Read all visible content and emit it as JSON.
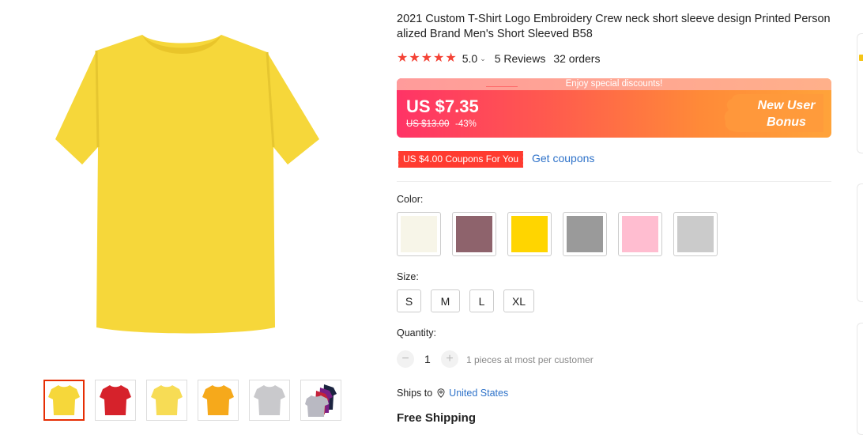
{
  "product": {
    "title": "2021 Custom T-Shirt Logo Embroidery Crew neck short sleeve design Printed Person alized Brand Men's Short Sleeved B58",
    "rating": "5.0",
    "reviews": "5 Reviews",
    "orders": "32 orders",
    "stars": 5
  },
  "gallery": {
    "main_color": "#f6d73a",
    "thumbnails": [
      {
        "color": "#f6d73a",
        "selected": true
      },
      {
        "color": "#d6222b",
        "selected": false
      },
      {
        "color": "#f7dc55",
        "selected": false
      },
      {
        "color": "#f6a91b",
        "selected": false
      },
      {
        "color": "#c9c9cc",
        "selected": false
      },
      {
        "color": "multi",
        "selected": false
      }
    ]
  },
  "price_banner": {
    "top_text": "Enjoy special discounts!",
    "price": "US $7.35",
    "original_price": "US $13.00",
    "discount": "-43%",
    "bonus_line1": "New User",
    "bonus_line2": "Bonus"
  },
  "coupons": {
    "badge": "US $4.00 Coupons For You",
    "link": "Get coupons"
  },
  "color": {
    "label": "Color:",
    "swatches": [
      "#f7f5e8",
      "#8e636c",
      "#ffd500",
      "#9a9a9a",
      "#ffbdd0",
      "#cbcbcb"
    ]
  },
  "size": {
    "label": "Size:",
    "options": [
      "S",
      "M",
      "L",
      "XL"
    ]
  },
  "quantity": {
    "label": "Quantity:",
    "minus": "−",
    "plus": "+",
    "value": "1",
    "note": "1 pieces at most per customer"
  },
  "shipping": {
    "ships_to": "Ships to",
    "country": "United States",
    "free": "Free Shipping"
  }
}
